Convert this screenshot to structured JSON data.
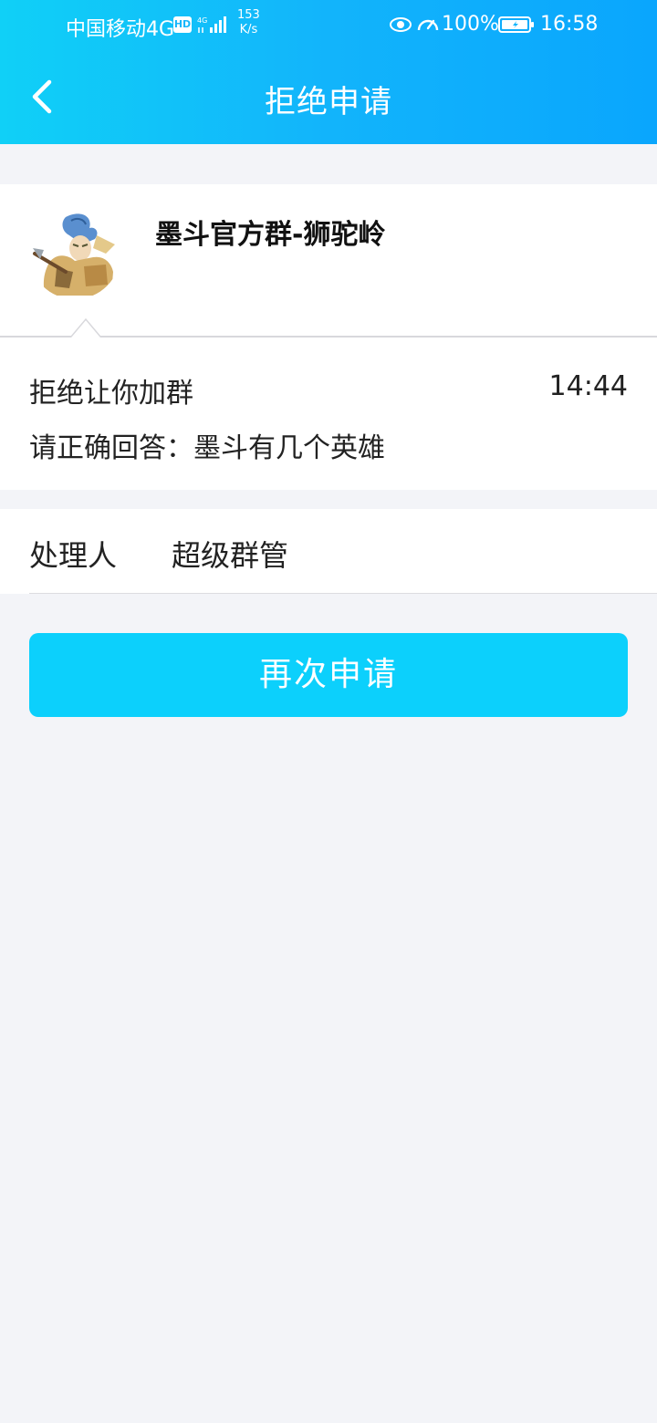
{
  "status_bar": {
    "carrier": "中国移动4G",
    "hd_badge": "HD",
    "signal_label": "4G",
    "net_speed_value": "153",
    "net_speed_unit": "K/s",
    "battery": "100%",
    "time": "16:58"
  },
  "header": {
    "title": "拒绝申请",
    "back_icon": "chevron-left-icon"
  },
  "group": {
    "name": "墨斗官方群-狮驼岭"
  },
  "message": {
    "status": "拒绝让你加群",
    "time": "14:44",
    "question": "请正确回答：墨斗有几个英雄"
  },
  "handler": {
    "label": "处理人",
    "value": "超级群管"
  },
  "actions": {
    "reapply_label": "再次申请"
  },
  "colors": {
    "header_start": "#10d0f7",
    "header_end": "#0aa6fd",
    "button": "#0cd0fc",
    "background": "#f3f4f8"
  }
}
